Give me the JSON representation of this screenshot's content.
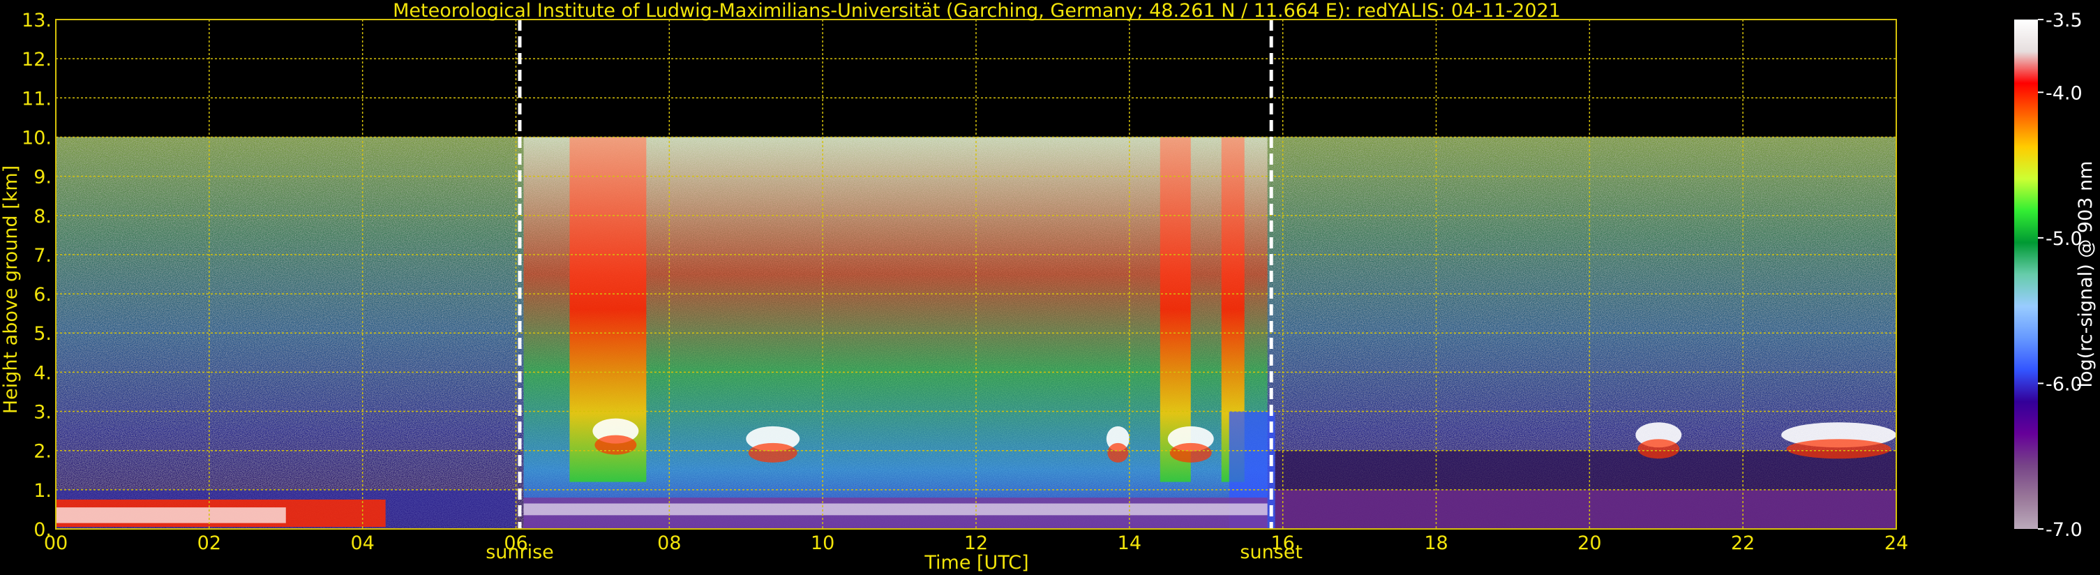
{
  "chart_data": {
    "type": "heatmap",
    "title": "Meteorological Institute of Ludwig-Maximilians-Universität (Garching, Germany; 48.261 N / 11.664 E):    redYALIS: 04-11-2021",
    "xlabel": "Time [UTC]",
    "ylabel": "Height above ground [km]",
    "xlim": [
      0,
      24
    ],
    "ylim": [
      0,
      13
    ],
    "x_ticks": [
      "00",
      "02",
      "04",
      "06",
      "08",
      "10",
      "12",
      "14",
      "16",
      "18",
      "20",
      "22",
      "24"
    ],
    "y_ticks": [
      "0.",
      "1.",
      "2.",
      "3.",
      "4.",
      "5.",
      "6.",
      "7.",
      "8.",
      "9.",
      "10.",
      "11.",
      "12.",
      "13."
    ],
    "grid": true,
    "markers": [
      {
        "label": "sunrise",
        "x": 6.05
      },
      {
        "label": "sunset",
        "x": 15.85
      }
    ],
    "colorbar": {
      "label": "log(rc-signal) @ 903 nm",
      "range": [
        -7.0,
        -3.5
      ],
      "ticks": [
        "-3.5",
        "-4.0",
        "-5.0",
        "-6.0",
        "-7.0"
      ],
      "colors": [
        "#ffffff",
        "#e6dede",
        "#ff0000",
        "#ff6600",
        "#ffcc00",
        "#ccff33",
        "#33ee33",
        "#009933",
        "#66ccaa",
        "#99ccff",
        "#6699ff",
        "#3355ff",
        "#330099",
        "#660099",
        "#774488",
        "#997799",
        "#bbaabb"
      ]
    },
    "signal_top_km": 10.0,
    "features": [
      {
        "name": "boundary layer",
        "x_start": 0,
        "x_end": 24,
        "height_km": 0.7
      },
      {
        "name": "cloud",
        "x_start": 7.0,
        "x_end": 7.6,
        "height_km": 2.5
      },
      {
        "name": "cloud",
        "x_start": 9.0,
        "x_end": 9.7,
        "height_km": 2.3
      },
      {
        "name": "cloud",
        "x_start": 13.7,
        "x_end": 14.0,
        "height_km": 2.3
      },
      {
        "name": "cloud",
        "x_start": 14.5,
        "x_end": 15.1,
        "height_km": 2.3
      },
      {
        "name": "cloud",
        "x_start": 20.6,
        "x_end": 21.2,
        "height_km": 2.4
      },
      {
        "name": "cloud",
        "x_start": 22.5,
        "x_end": 24.0,
        "height_km": 2.4
      }
    ]
  }
}
